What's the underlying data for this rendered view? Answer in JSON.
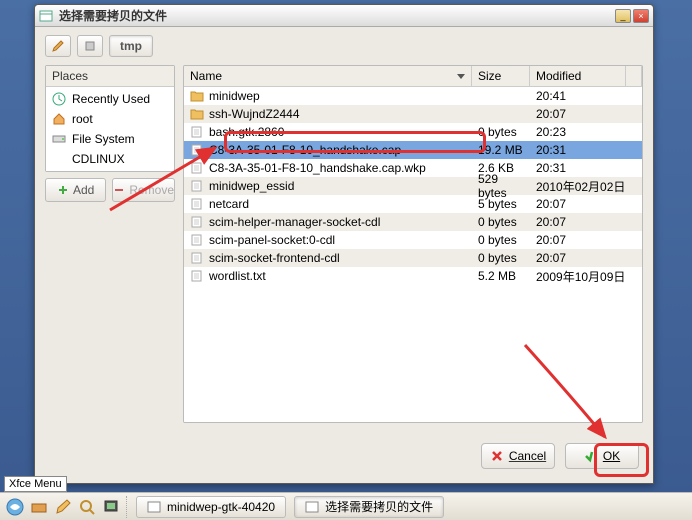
{
  "window": {
    "title": "选择需要拷贝的文件"
  },
  "pathbar": {
    "current": "tmp"
  },
  "places": {
    "header": "Places",
    "items": [
      {
        "label": "Recently Used",
        "icon": "clock"
      },
      {
        "label": "root",
        "icon": "home"
      },
      {
        "label": "File System",
        "icon": "drive"
      },
      {
        "label": "CDLINUX",
        "icon": "blank"
      }
    ]
  },
  "placesButtons": {
    "add": "Add",
    "remove": "Remove"
  },
  "columns": {
    "name": "Name",
    "size": "Size",
    "modified": "Modified"
  },
  "files": [
    {
      "name": "minidwep",
      "size": "",
      "modified": "20:41",
      "type": "folder",
      "selected": false
    },
    {
      "name": "ssh-WujndZ2444",
      "size": "",
      "modified": "20:07",
      "type": "folder",
      "selected": false
    },
    {
      "name": "bash.gtk.2860",
      "size": "0 bytes",
      "modified": "20:23",
      "type": "file",
      "selected": false
    },
    {
      "name": "C8-3A-35-01-F8-10_handshake.cap",
      "size": "19.2 MB",
      "modified": "20:31",
      "type": "file",
      "selected": true
    },
    {
      "name": "C8-3A-35-01-F8-10_handshake.cap.wkp",
      "size": "2.6 KB",
      "modified": "20:31",
      "type": "file",
      "selected": false
    },
    {
      "name": "minidwep_essid",
      "size": "529 bytes",
      "modified": "2010年02月02日",
      "type": "file",
      "selected": false
    },
    {
      "name": "netcard",
      "size": "5 bytes",
      "modified": "20:07",
      "type": "file",
      "selected": false
    },
    {
      "name": "scim-helper-manager-socket-cdl",
      "size": "0 bytes",
      "modified": "20:07",
      "type": "file",
      "selected": false
    },
    {
      "name": "scim-panel-socket:0-cdl",
      "size": "0 bytes",
      "modified": "20:07",
      "type": "file",
      "selected": false
    },
    {
      "name": "scim-socket-frontend-cdl",
      "size": "0 bytes",
      "modified": "20:07",
      "type": "file",
      "selected": false
    },
    {
      "name": "wordlist.txt",
      "size": "5.2 MB",
      "modified": "2009年10月09日",
      "type": "file",
      "selected": false
    }
  ],
  "buttons": {
    "cancel": "Cancel",
    "ok": "OK"
  },
  "taskbar": {
    "xfce": "Xfce Menu",
    "task1": "minidwep-gtk-40420",
    "task2": "选择需要拷贝的文件"
  }
}
